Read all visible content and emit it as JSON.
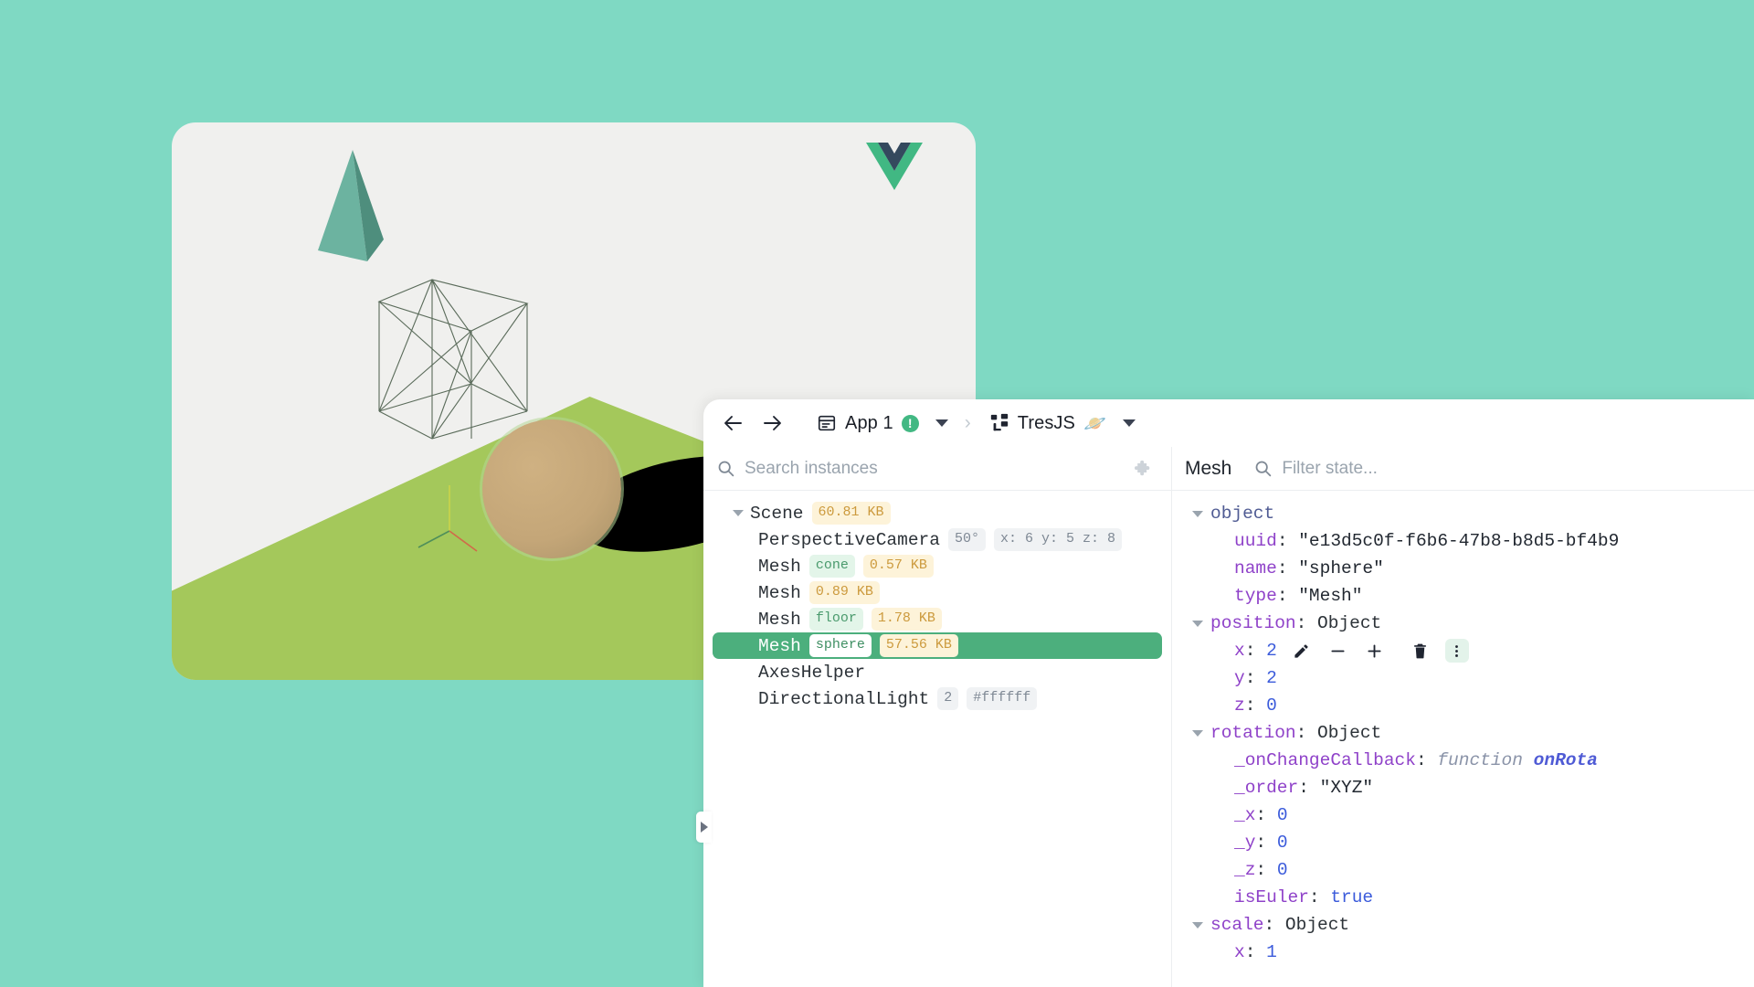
{
  "scene": {
    "logo": "vue-logo",
    "objects": [
      "cone",
      "cube-wireframe",
      "sphere",
      "floor",
      "axes-helper"
    ]
  },
  "toolbar": {
    "back_label": "back",
    "forward_label": "forward",
    "app_label": "App 1",
    "app_badge": "!",
    "separator": "›",
    "plugin_label": "TresJS",
    "plugin_emoji": "🪐"
  },
  "tree_panel": {
    "search_placeholder": "Search instances",
    "search_value": "",
    "nodes": [
      {
        "depth": 0,
        "twisty": true,
        "label": "Scene",
        "tags": [
          {
            "text": "60.81 KB",
            "kind": "size"
          }
        ],
        "selected": false
      },
      {
        "depth": 1,
        "twisty": false,
        "label": "PerspectiveCamera",
        "tags": [
          {
            "text": "50°",
            "kind": "plain"
          },
          {
            "text": "x: 6 y: 5 z: 8",
            "kind": "plain"
          }
        ],
        "selected": false
      },
      {
        "depth": 1,
        "twisty": false,
        "label": "Mesh",
        "tags": [
          {
            "text": "cone",
            "kind": "name"
          },
          {
            "text": "0.57 KB",
            "kind": "size"
          }
        ],
        "selected": false
      },
      {
        "depth": 1,
        "twisty": false,
        "label": "Mesh",
        "tags": [
          {
            "text": "0.89 KB",
            "kind": "size"
          }
        ],
        "selected": false
      },
      {
        "depth": 1,
        "twisty": false,
        "label": "Mesh",
        "tags": [
          {
            "text": "floor",
            "kind": "name"
          },
          {
            "text": "1.78 KB",
            "kind": "size"
          }
        ],
        "selected": false
      },
      {
        "depth": 1,
        "twisty": false,
        "label": "Mesh",
        "tags": [
          {
            "text": "sphere",
            "kind": "name"
          },
          {
            "text": "57.56 KB",
            "kind": "size"
          }
        ],
        "selected": true
      },
      {
        "depth": 1,
        "twisty": false,
        "label": "AxesHelper",
        "tags": [],
        "selected": false
      },
      {
        "depth": 1,
        "twisty": false,
        "label": "DirectionalLight",
        "tags": [
          {
            "text": "2",
            "kind": "plain"
          },
          {
            "text": "#ffffff",
            "kind": "plain"
          }
        ],
        "selected": false
      }
    ]
  },
  "state_panel": {
    "title": "Mesh",
    "filter_placeholder": "Filter state...",
    "filter_value": "",
    "rows": [
      {
        "indent": 0,
        "twisty": true,
        "key": "object",
        "key_kind": "obj",
        "value": "",
        "value_kind": "none",
        "actions": false
      },
      {
        "indent": 1,
        "twisty": false,
        "key": "uuid",
        "key_kind": "prop",
        "value": "\"e13d5c0f-f6b6-47b8-b8d5-bf4b9",
        "value_kind": "str",
        "actions": false
      },
      {
        "indent": 1,
        "twisty": false,
        "key": "name",
        "key_kind": "prop",
        "value": "\"sphere\"",
        "value_kind": "str",
        "actions": false
      },
      {
        "indent": 1,
        "twisty": false,
        "key": "type",
        "key_kind": "prop",
        "value": "\"Mesh\"",
        "value_kind": "str",
        "actions": false
      },
      {
        "indent": 0,
        "twisty": true,
        "key": "position",
        "key_kind": "prop",
        "value": "Object",
        "value_kind": "plain",
        "actions": false
      },
      {
        "indent": 1,
        "twisty": false,
        "key": "x",
        "key_kind": "prop",
        "value": "2",
        "value_kind": "num",
        "actions": true
      },
      {
        "indent": 1,
        "twisty": false,
        "key": "y",
        "key_kind": "prop",
        "value": "2",
        "value_kind": "num",
        "actions": false
      },
      {
        "indent": 1,
        "twisty": false,
        "key": "z",
        "key_kind": "prop",
        "value": "0",
        "value_kind": "num",
        "actions": false
      },
      {
        "indent": 0,
        "twisty": true,
        "key": "rotation",
        "key_kind": "prop",
        "value": "Object",
        "value_kind": "plain",
        "actions": false
      },
      {
        "indent": 1,
        "twisty": false,
        "key": "_onChangeCallback",
        "key_kind": "prop",
        "value": "function onRota",
        "value_kind": "fn",
        "actions": false
      },
      {
        "indent": 1,
        "twisty": false,
        "key": "_order",
        "key_kind": "prop",
        "value": "\"XYZ\"",
        "value_kind": "str",
        "actions": false
      },
      {
        "indent": 1,
        "twisty": false,
        "key": "_x",
        "key_kind": "prop",
        "value": "0",
        "value_kind": "num",
        "actions": false
      },
      {
        "indent": 1,
        "twisty": false,
        "key": "_y",
        "key_kind": "prop",
        "value": "0",
        "value_kind": "num",
        "actions": false
      },
      {
        "indent": 1,
        "twisty": false,
        "key": "_z",
        "key_kind": "prop",
        "value": "0",
        "value_kind": "num",
        "actions": false
      },
      {
        "indent": 1,
        "twisty": false,
        "key": "isEuler",
        "key_kind": "prop",
        "value": "true",
        "value_kind": "bool",
        "actions": false
      },
      {
        "indent": 0,
        "twisty": true,
        "key": "scale",
        "key_kind": "prop",
        "value": "Object",
        "value_kind": "plain",
        "actions": false
      },
      {
        "indent": 1,
        "twisty": false,
        "key": "x",
        "key_kind": "prop",
        "value": "1",
        "value_kind": "num",
        "actions": false
      }
    ],
    "row_action_icons": [
      "edit-icon",
      "decrement-icon",
      "increment-icon",
      "delete-icon",
      "more-options-icon"
    ],
    "fn_keyword": "function",
    "fn_name": "onRota"
  },
  "colors": {
    "background": "#7fd9c3",
    "accent_green": "#42b883",
    "selected_row": "#4caf7d",
    "floor": "#a4c85b",
    "cone": "#59a391",
    "sphere": "#c4a678"
  }
}
